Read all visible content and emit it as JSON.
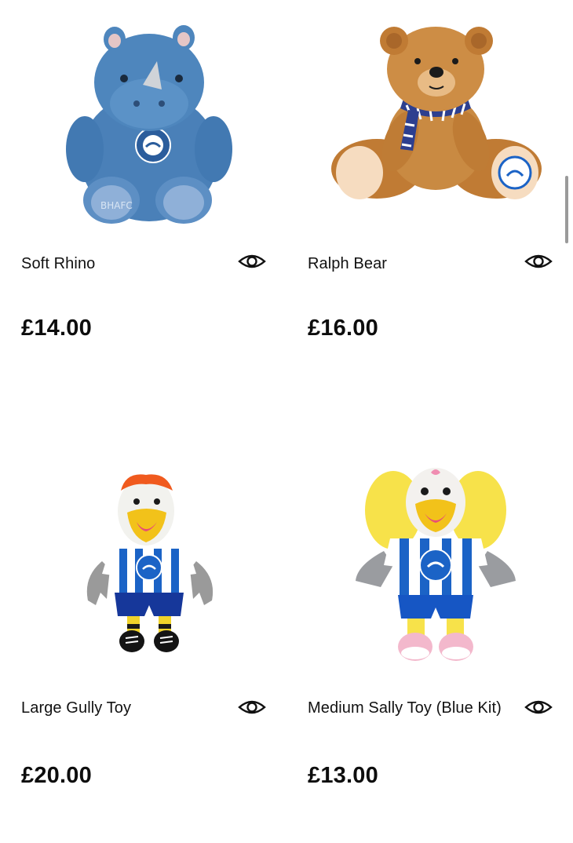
{
  "products": [
    {
      "name": "Soft Rhino",
      "price": "£14.00",
      "image": "soft-rhino-plush",
      "quickview_icon": "eye-icon"
    },
    {
      "name": "Ralph Bear",
      "price": "£16.00",
      "image": "ralph-bear-plush",
      "quickview_icon": "eye-icon"
    },
    {
      "name": "Large Gully Toy",
      "price": "£20.00",
      "image": "gully-mascot-plush",
      "quickview_icon": "eye-icon"
    },
    {
      "name": "Medium Sally Toy (Blue Kit)",
      "price": "£13.00",
      "image": "sally-mascot-plush",
      "quickview_icon": "eye-icon"
    }
  ],
  "colors": {
    "text": "#111111",
    "kit_blue": "#1560c2",
    "rhino_blue": "#4e86bd",
    "bear_brown": "#c7823a"
  }
}
